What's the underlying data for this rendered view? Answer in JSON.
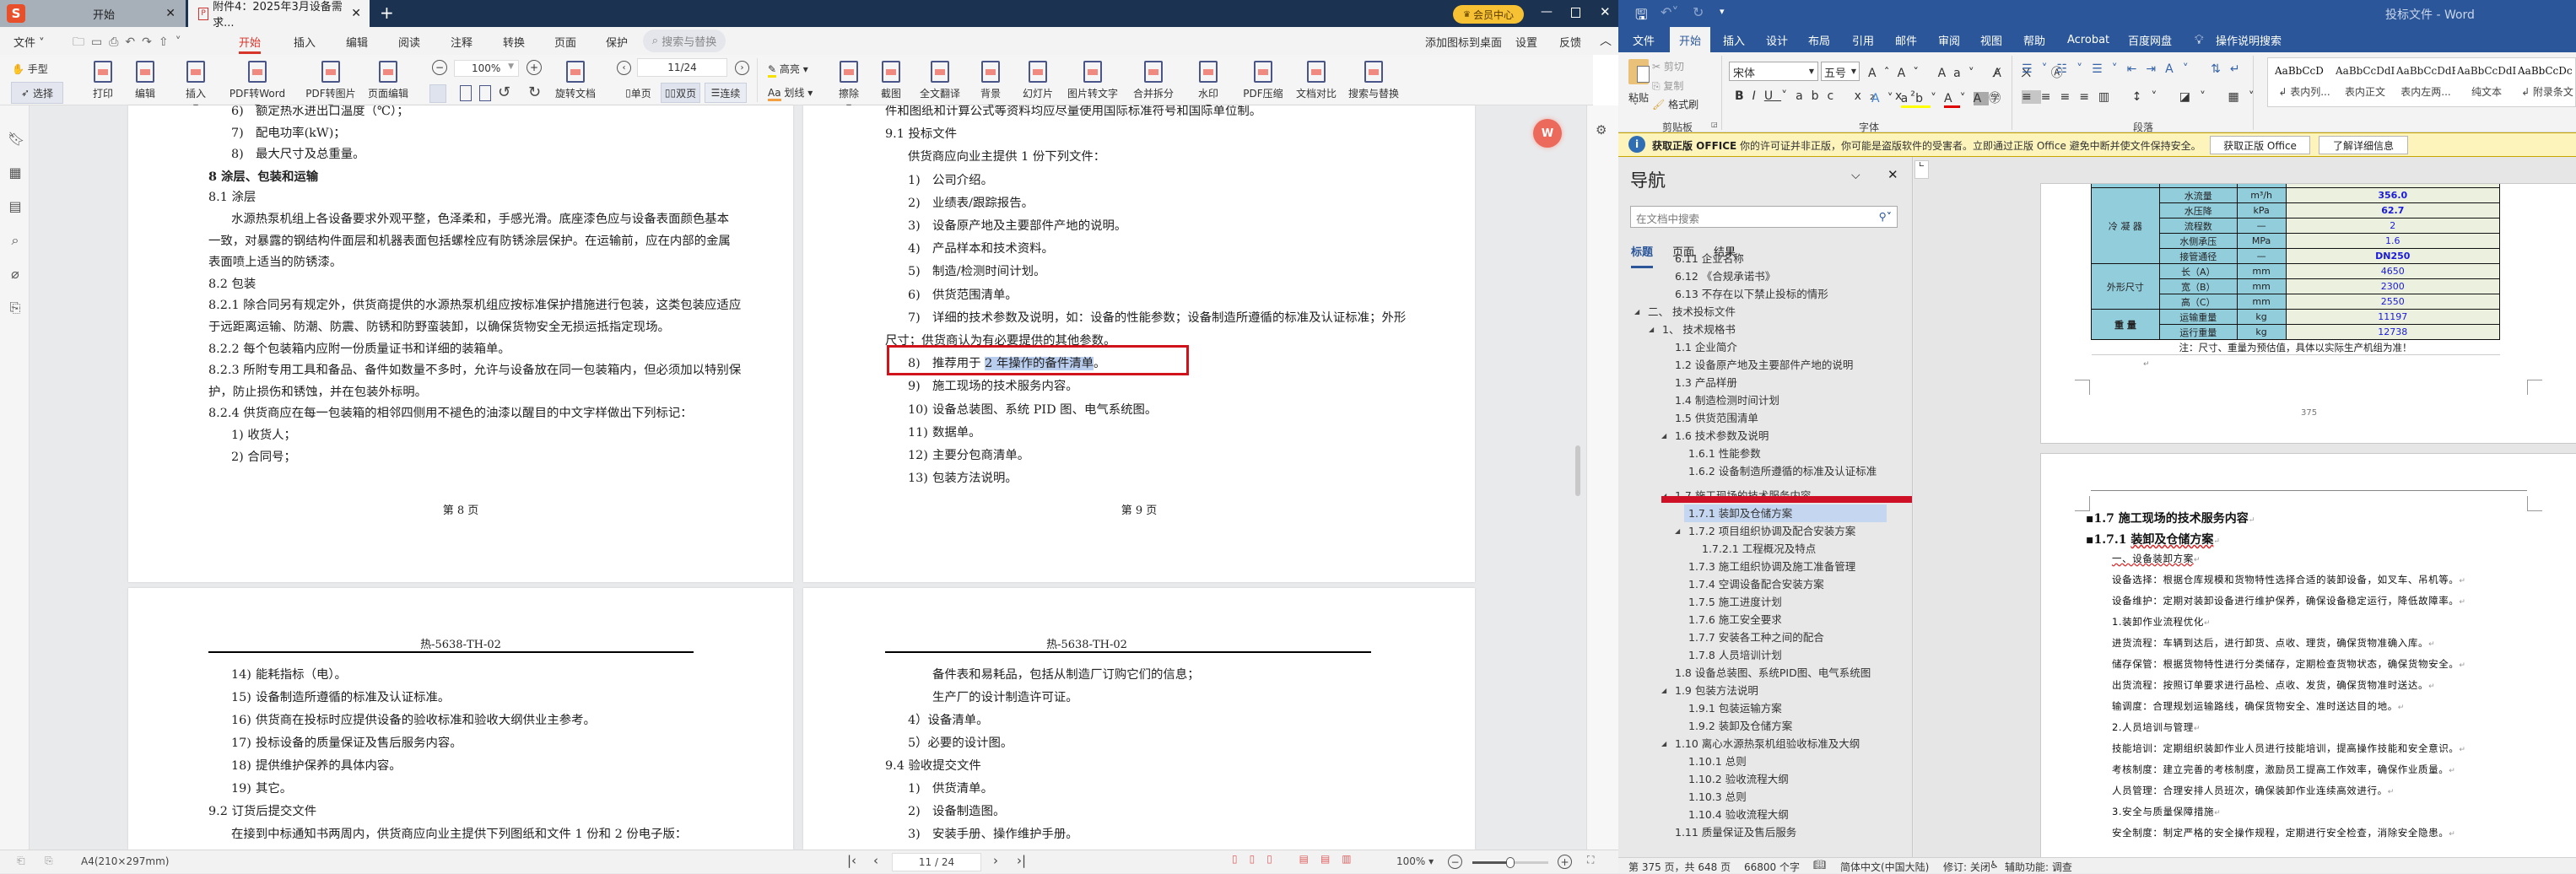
{
  "wps": {
    "tabs": [
      {
        "label": "开始"
      },
      {
        "label": "附件4：2025年3月设备需求..."
      }
    ],
    "vip_label": "会员中心",
    "menu": {
      "file": "文件",
      "tabs": [
        "开始",
        "插入",
        "编辑",
        "阅读",
        "注释",
        "转换",
        "页面",
        "保护"
      ],
      "search": "搜索与替换",
      "add_icon": "添加图标到桌面",
      "settings": "设置",
      "feedback": "反馈"
    },
    "toolbar": {
      "hand": "手型",
      "select": "选择",
      "print": "打印",
      "edit": "编辑",
      "insert": "插入",
      "pdf_to_word": "PDF转Word",
      "pdf_to_image": "PDF转图片",
      "page_edit": "页面编辑",
      "zoom": "100%",
      "rotate": "旋转文档",
      "page": "11/24",
      "single": "单页",
      "double": "双页",
      "continuous": "连续",
      "highlight": "高亮",
      "strike": "划线",
      "erase": "擦除",
      "screenshot": "截图",
      "translate": "全文翻译",
      "background": "背景",
      "slides": "幻灯片",
      "ocr": "图片转文字",
      "merge_split": "合并拆分",
      "watermark": "水印",
      "compress": "PDF压缩",
      "compare": "文档对比",
      "search_replace": "搜索与替换"
    },
    "pages": {
      "p8_top": {
        "footer": "第 8 页",
        "lines": [
          {
            "kind": "item",
            "n": "6)",
            "t": "额定热水进出口温度（℃）；"
          },
          {
            "kind": "item",
            "n": "7)",
            "t": "配电功率(kW)；"
          },
          {
            "kind": "item",
            "n": "8)",
            "t": "最大尺寸及总重量。"
          },
          {
            "kind": "h",
            "t": "8  涂层、包装和运输"
          },
          {
            "kind": "plain",
            "t": "8.1 涂层"
          },
          {
            "kind": "ind",
            "t": "水源热泵机组上各设备要求外观平整，色泽柔和，手感光滑。底座漆色应与设备表面颜色基本"
          },
          {
            "kind": "plain",
            "t": "一致，对暴露的钢结构件面层和机器表面包括螺栓应有防锈涂层保护。在运输前，应在内部的金属"
          },
          {
            "kind": "plain",
            "t": "表面喷上适当的防锈漆。"
          },
          {
            "kind": "plain",
            "t": "8.2 包装"
          },
          {
            "kind": "plain",
            "t": "8.2.1 除合同另有规定外，供货商提供的水源热泵机组应按标准保护措施进行包装，这类包装应适应"
          },
          {
            "kind": "plain",
            "t": "于远距离运输、防潮、防震、防锈和防野蛮装卸，以确保货物安全无损运抵指定现场。"
          },
          {
            "kind": "plain",
            "t": "8.2.2 每个包装箱内应附一份质量证书和详细的装箱单。"
          },
          {
            "kind": "plain",
            "t": "8.2.3 所附专用工具和备品、备件如数量不多时，允许与设备放在同一包装箱内，但必须加以特别保"
          },
          {
            "kind": "plain",
            "t": "护，防止损伤和锈蚀，并在包装外标明。"
          },
          {
            "kind": "plain",
            "t": "8.2.4 供货商应在每一包装箱的相邻四侧用不褪色的油漆以醒目的中文字样做出下列标记："
          },
          {
            "kind": "ind",
            "t": "1) 收货人；"
          },
          {
            "kind": "ind",
            "t": "2) 合同号；"
          }
        ]
      },
      "p9_top": {
        "footer": "第 9 页",
        "lines": [
          {
            "kind": "plain",
            "t": "件和图纸和计算公式等资料均应尽量使用国际标准符号和国际单位制。"
          },
          {
            "kind": "plain",
            "t": "9.1 投标文件"
          },
          {
            "kind": "ind",
            "t": "供货商应向业主提供 1 份下列文件："
          },
          {
            "kind": "item",
            "n": "1)",
            "t": "公司介绍。"
          },
          {
            "kind": "item",
            "n": "2)",
            "t": "业绩表/跟踪报告。"
          },
          {
            "kind": "item",
            "n": "3)",
            "t": "设备原产地及主要部件产地的说明。"
          },
          {
            "kind": "item",
            "n": "4)",
            "t": "产品样本和技术资料。"
          },
          {
            "kind": "item",
            "n": "5)",
            "t": "制造/检测时间计划。"
          },
          {
            "kind": "item",
            "n": "6)",
            "t": "供货范围清单。"
          },
          {
            "kind": "item",
            "n": "7)",
            "t": "详细的技术参数及说明，如：设备的性能参数；设备制造所遵循的标准及认证标准；外形"
          },
          {
            "kind": "plain",
            "t": "尺寸；供货商认为有必要提供的其他参数。"
          },
          {
            "kind": "item",
            "n": "8)",
            "t": "推荐用于 ",
            "sel": "2 年操作的备件清单",
            "after": "。"
          },
          {
            "kind": "item",
            "n": "9)",
            "t": "施工现场的技术服务内容。"
          },
          {
            "kind": "item",
            "n": "10)",
            "t": "设备总装图、系统 PID 图、电气系统图。"
          },
          {
            "kind": "item",
            "n": "11)",
            "t": "数据单。"
          },
          {
            "kind": "item",
            "n": "12)",
            "t": "主要分包商清单。"
          },
          {
            "kind": "item",
            "n": "13)",
            "t": "包装方法说明。"
          }
        ]
      },
      "p10_bottom": {
        "header": "热-5638-TH-02",
        "lines": [
          {
            "kind": "item",
            "n": "14)",
            "t": "能耗指标（电）。"
          },
          {
            "kind": "item",
            "n": "15)",
            "t": "设备制造所遵循的标准及认证标准。"
          },
          {
            "kind": "item",
            "n": "16)",
            "t": "供货商在投标时应提供设备的验收标准和验收大纲供业主参考。"
          },
          {
            "kind": "item",
            "n": "17)",
            "t": "投标设备的质量保证及售后服务内容。"
          },
          {
            "kind": "item",
            "n": "18)",
            "t": "提供维护保养的具体内容。"
          },
          {
            "kind": "item",
            "n": "19)",
            "t": "其它。"
          },
          {
            "kind": "plain",
            "t": "9.2 订货后提交文件"
          },
          {
            "kind": "ind",
            "t": "在接到中标通知书两周内，供货商应向业主提供下列图纸和文件 1 份和 2 份电子版："
          }
        ]
      },
      "p11_bottom": {
        "header": "热-5638-TH-02",
        "lines": [
          {
            "kind": "item",
            "n": "",
            "t": "备件表和易耗品，包括从制造厂订购它们的信息；"
          },
          {
            "kind": "item",
            "n": "",
            "t": "生产厂的设计制造许可证。"
          },
          {
            "kind": "ind",
            "t": "4）设备清单。"
          },
          {
            "kind": "ind",
            "t": "5）必要的设计图。"
          },
          {
            "kind": "plain",
            "t": "9.4 验收提交文件"
          },
          {
            "kind": "item",
            "n": "1)",
            "t": "供货清单。"
          },
          {
            "kind": "item",
            "n": "2)",
            "t": "设备制造图。"
          },
          {
            "kind": "item",
            "n": "3)",
            "t": "安装手册、操作维护手册。"
          }
        ]
      }
    },
    "status": {
      "paper": "A4(210×297mm)",
      "page": "11 / 24",
      "zoom": "100%"
    }
  },
  "word": {
    "title": "投标文件  -  Word",
    "tabs": [
      "文件",
      "开始",
      "插入",
      "设计",
      "布局",
      "引用",
      "邮件",
      "审阅",
      "视图",
      "帮助",
      "Acrobat",
      "百度网盘"
    ],
    "tell_me": "操作说明搜索",
    "clipboard": {
      "paste": "粘贴",
      "cut": "剪切",
      "copy": "复制",
      "format_painter": "格式刷",
      "group": "剪贴板"
    },
    "font": {
      "name": "宋体",
      "size": "五号",
      "group": "字体"
    },
    "paragraph": {
      "group": "段落"
    },
    "styles": [
      {
        "preview": "AaBbCcD",
        "name": "↲ 表内列..."
      },
      {
        "preview": "AaBbCcDdI",
        "name": "表内正文"
      },
      {
        "preview": "AaBbCcDdEe",
        "name": "表内左两..."
      },
      {
        "preview": "AaBbCcDdI",
        "name": "纯文本"
      },
      {
        "preview": "AaBbCcDc",
        "name": "↲ 附录条文"
      }
    ],
    "notice": {
      "title": "获取正版 OFFICE",
      "message": "你的许可证并非正版，你可能是盗版软件的受害者。立即通过正版 Office 避免中断并使文件保持安全。",
      "get_button": "获取正版 Office",
      "learn_button": "了解详细信息"
    },
    "nav": {
      "title": "导航",
      "search_placeholder": "在文档中搜索",
      "tabs": [
        "标题",
        "页面",
        "结果"
      ],
      "items": [
        {
          "label": "6.11 企业名称",
          "level": 3,
          "toggle": false
        },
        {
          "label": "6.12 《合规承诺书》",
          "level": 3,
          "toggle": false
        },
        {
          "label": "6.13 不存在以下禁止投标的情形",
          "level": 3,
          "toggle": false
        },
        {
          "label": "二、 技术投标文件",
          "level": 1,
          "toggle": true
        },
        {
          "label": "1、 技术规格书",
          "level": 2,
          "toggle": true
        },
        {
          "label": "1.1 企业简介",
          "level": 3,
          "toggle": false
        },
        {
          "label": "1.2 设备原产地及主要部件产地的说明",
          "level": 3,
          "toggle": false
        },
        {
          "label": "1.3 产品样册",
          "level": 3,
          "toggle": false
        },
        {
          "label": "1.4 制造检测时间计划",
          "level": 3,
          "toggle": false
        },
        {
          "label": "1.5 供货范围清单",
          "level": 3,
          "toggle": false
        },
        {
          "label": "1.6 技术参数及说明",
          "level": 3,
          "toggle": true
        },
        {
          "label": "1.6.1 性能参数",
          "level": 4,
          "toggle": false
        },
        {
          "label": "1.6.2 设备制造所遵循的标准及认证标准",
          "level": 4,
          "toggle": false
        },
        {
          "label": "1.7 施工现场的技术服务内容",
          "level": 3,
          "toggle": true
        },
        {
          "label": "1.7.1 装卸及仓储方案",
          "level": 4,
          "toggle": false,
          "selected": true
        },
        {
          "label": "1.7.2 项目组织协调及配合安装方案",
          "level": 4,
          "toggle": true
        },
        {
          "label": "1.7.2.1 工程概况及特点",
          "level": 5,
          "toggle": false
        },
        {
          "label": "1.7.3 施工组织协调及施工准备管理",
          "level": 4,
          "toggle": false
        },
        {
          "label": "1.7.4 空调设备配合安装方案",
          "level": 4,
          "toggle": false
        },
        {
          "label": "1.7.5 施工进度计划",
          "level": 4,
          "toggle": false
        },
        {
          "label": "1.7.6 施工安全要求",
          "level": 4,
          "toggle": false
        },
        {
          "label": "1.7.7 安装各工种之间的配合",
          "level": 4,
          "toggle": false
        },
        {
          "label": "1.7.8 人员培训计划",
          "level": 4,
          "toggle": false
        },
        {
          "label": "1.8 设备总装图、系统PID图、电气系统图",
          "level": 3,
          "toggle": false
        },
        {
          "label": "1.9 包装方法说明",
          "level": 3,
          "toggle": true
        },
        {
          "label": "1.9.1 包装运输方案",
          "level": 4,
          "toggle": false
        },
        {
          "label": "1.9.2 装卸及仓储方案",
          "level": 4,
          "toggle": false
        },
        {
          "label": "1.10 离心水源热泵机组验收标准及大纲",
          "level": 3,
          "toggle": true
        },
        {
          "label": "1.10.1 总则",
          "level": 4,
          "toggle": false
        },
        {
          "label": "1.10.2 验收流程大纲",
          "level": 4,
          "toggle": false
        },
        {
          "label": "1.10.3 总则",
          "level": 4,
          "toggle": false
        },
        {
          "label": "1.10.4  验收流程大纲",
          "level": 4,
          "toggle": false
        },
        {
          "label": "1.11 质量保证及售后服务",
          "level": 3,
          "toggle": false
        }
      ]
    },
    "table": {
      "groups": [
        {
          "name": "冷 凝 器",
          "rows": [
            {
              "item": "水流量",
              "unit": "m³/h",
              "value": "356.0",
              "bold": true
            },
            {
              "item": "水压降",
              "unit": "kPa",
              "value": "62.7",
              "bold": true
            },
            {
              "item": "流程数",
              "unit": "—",
              "value": "2",
              "bold": false
            },
            {
              "item": "水侧承压",
              "unit": "MPa",
              "value": "1.6",
              "bold": false
            },
            {
              "item": "接管通径",
              "unit": "—",
              "value": "DN250",
              "bold": true
            }
          ]
        },
        {
          "name": "外形尺寸",
          "rows": [
            {
              "item": "长（A）",
              "unit": "mm",
              "value": "4650",
              "bold": false
            },
            {
              "item": "宽（B）",
              "unit": "mm",
              "value": "2300",
              "bold": false
            },
            {
              "item": "高（C）",
              "unit": "mm",
              "value": "2550",
              "bold": false
            }
          ]
        },
        {
          "name": "重 量",
          "rows": [
            {
              "item": "运输重量",
              "unit": "kg",
              "value": "11197",
              "bold": false
            },
            {
              "item": "运行重量",
              "unit": "kg",
              "value": "12738",
              "bold": false
            }
          ]
        }
      ],
      "note": "注：尺寸、重量为预估值，具体以实际生产机组为准！"
    },
    "page_number": "375",
    "doc_lines": [
      {
        "kind": "h",
        "t": "1.7 施工现场的技术服务内容"
      },
      {
        "kind": "h",
        "t": "1.7.1   ",
        "squig": "装卸及仓储方案"
      },
      {
        "kind": "p",
        "t": "",
        "squig": "一、设备装卸方案"
      },
      {
        "kind": "p",
        "t": "设备选择：根据仓库规模和货物特性选择合适的装卸设备，如叉车、吊机等。"
      },
      {
        "kind": "p",
        "t": "设备维护：定期对装卸设备进行维护保养，确保设备稳定运行，降低故障率。"
      },
      {
        "kind": "p",
        "t": "1.装卸作业流程优化"
      },
      {
        "kind": "p",
        "t": "进货流程：车辆到达后，进行卸货、点收、理货，确保货物准确入库。"
      },
      {
        "kind": "p",
        "t": "储存保管：根据货物特性进行分类储存，定期检查货物状态，确保货物安全。"
      },
      {
        "kind": "p",
        "t": "出货流程：按照订单要求进行品检、点收、发货，确保货物准时送达。"
      },
      {
        "kind": "p",
        "t": "输调度：合理规划运输路线，确保货物安全、准时送达目的地。"
      },
      {
        "kind": "p",
        "t": "2.人员培训与管理"
      },
      {
        "kind": "p",
        "t": "技能培训：定期组织装卸作业人员进行技能培训，提高操作技能和安全意识。"
      },
      {
        "kind": "p",
        "t": "考核制度：建立完善的考核制度，激励员工提高工作效率，确保作业质量。"
      },
      {
        "kind": "p",
        "t": "人员管理：合理安排人员班次，确保装卸作业连续高效进行。"
      },
      {
        "kind": "p",
        "t": "3.安全与质量保障措施"
      },
      {
        "kind": "p",
        "t": "安全制度：制定严格的安全操作规程，定期进行安全检查，消除安全隐患。"
      }
    ],
    "status": {
      "page": "第 375 页，共 648 页",
      "words": "66800 个字",
      "language": "简体中文(中国大陆)",
      "track": "修订: 关闭",
      "accessibility": "辅助功能: 调查"
    }
  }
}
